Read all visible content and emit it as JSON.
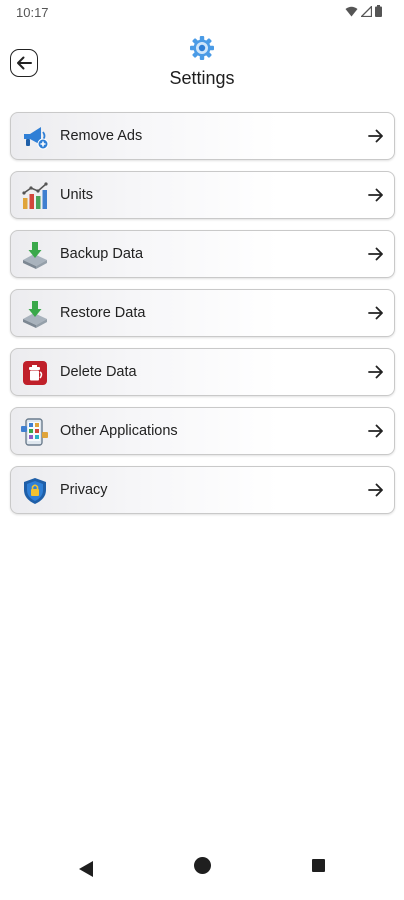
{
  "status_bar": {
    "time": "10:17"
  },
  "header": {
    "title": "Settings"
  },
  "menu": {
    "items": [
      {
        "label": "Remove Ads",
        "icon": "megaphone-icon"
      },
      {
        "label": "Units",
        "icon": "bar-chart-icon"
      },
      {
        "label": "Backup Data",
        "icon": "backup-download-icon"
      },
      {
        "label": "Restore Data",
        "icon": "restore-download-icon"
      },
      {
        "label": "Delete Data",
        "icon": "trash-icon"
      },
      {
        "label": "Other Applications",
        "icon": "apps-icon"
      },
      {
        "label": "Privacy",
        "icon": "shield-lock-icon"
      }
    ]
  },
  "colors": {
    "accent_blue": "#2f7fd6",
    "delete_red": "#c0202a",
    "text": "#222222"
  }
}
